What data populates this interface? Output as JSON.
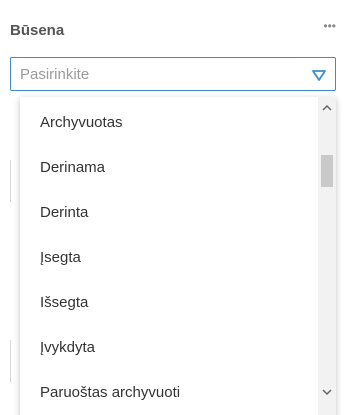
{
  "field": {
    "label": "Būsena",
    "more_icon": "more-horizontal-icon",
    "more_glyph": "•••"
  },
  "select": {
    "placeholder": "Pasirinkite",
    "arrow_icon": "triangle-down-icon"
  },
  "dropdown": {
    "options": [
      "Archyvuotas",
      "Derinama",
      "Derinta",
      "Įsegta",
      "Išsegta",
      "Įvykdyta",
      "Paruoštas archyvuoti"
    ]
  },
  "colors": {
    "accent": "#3b8fc9",
    "label": "#555555",
    "placeholder": "#9a9a9a",
    "option_text": "#333333",
    "scroll_thumb": "#c9c9c9"
  }
}
